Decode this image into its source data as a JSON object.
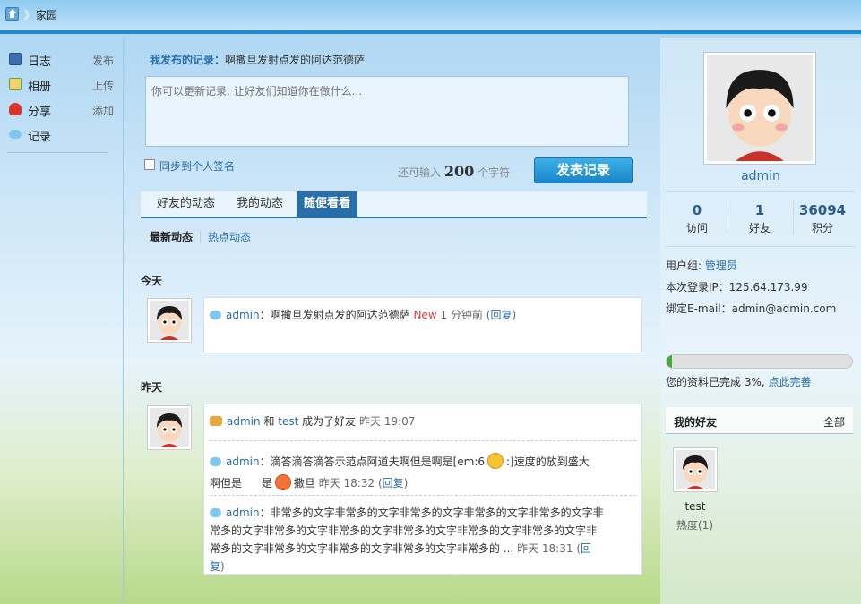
{
  "topbar": {
    "title": "家园",
    "separator": "》"
  },
  "sidebar": {
    "items": [
      {
        "label": "日志",
        "action": "发布",
        "icon": "blog-icon",
        "color": "#3d6fb0"
      },
      {
        "label": "相册",
        "action": "上传",
        "icon": "album-icon",
        "color": "#5aa64a"
      },
      {
        "label": "分享",
        "action": "添加",
        "icon": "share-icon",
        "color": "#d9342b"
      },
      {
        "label": "记录",
        "action": "",
        "icon": "record-icon",
        "color": "#7dc8ec"
      }
    ]
  },
  "composer": {
    "my_record_label": "我发布的记录：",
    "my_record_text": "啊撒旦发射点发的阿达范德萨",
    "placeholder": "你可以更新记录, 让好友们知道你在做什么...",
    "sync_label": "同步到个人签名",
    "remain_prefix": "还可输入",
    "remain_count": "200",
    "remain_suffix": "个字符",
    "post_button": "发表记录"
  },
  "tabs": [
    "好友的动态",
    "我的动态",
    "随便看看"
  ],
  "active_tab": "随便看看",
  "subtabs": {
    "active": "最新动态",
    "other": "热点动态"
  },
  "feed": {
    "today_label": "今天",
    "yesterday_label": "昨天",
    "today": {
      "user": "admin",
      "text": "：啊撒旦发射点发的阿达范德萨",
      "new_tag": "New",
      "time": "1 分钟前",
      "reply": "回复"
    },
    "yesterday": [
      {
        "user": "admin",
        "mid": "和",
        "user2": "test",
        "text": "成为了好友",
        "time": "昨天 19:07"
      },
      {
        "user": "admin",
        "text": "：滴答滴答滴答示范点阿道夫啊但是啊是[em:6",
        "text2": ":]速度的放到盛大啊但是",
        "text3": "撒旦",
        "time": "昨天 18:32",
        "reply": "回复"
      },
      {
        "user": "admin",
        "text": "：非常多的文字非常多的文字非常多的文字非常多的文字非常多的文字非常多的文字非常多的文字非常多的文字非常多的文字非常多的文字非常多的文字非常多的文字非常多的文字非常多的文字非常多的文字非常多的 ...",
        "time": "昨天 18:31",
        "reply": "回复"
      }
    ]
  },
  "profile": {
    "name": "admin",
    "stats": [
      {
        "num": "0",
        "label": "访问"
      },
      {
        "num": "1",
        "label": "好友"
      },
      {
        "num": "36094",
        "label": "积分"
      }
    ],
    "group_label": "用户组:",
    "group_value": "管理员",
    "ip_label": "本次登录IP：",
    "ip_value": "125.64.173.99",
    "email_label": "绑定E-mail：",
    "email_value": "admin@admin.com",
    "progress_percent": 3,
    "progress_text": "您的资料已完成 3%,",
    "progress_link": "点此完善"
  },
  "friends": {
    "title": "我的好友",
    "all": "全部",
    "list": [
      {
        "name": "test",
        "heat": "热度(1)"
      }
    ]
  },
  "colors": {
    "accent": "#2a6ea8",
    "post_button": "#1e8fd0",
    "progress": "#3fae3a",
    "new_tag": "#e03b3b"
  }
}
